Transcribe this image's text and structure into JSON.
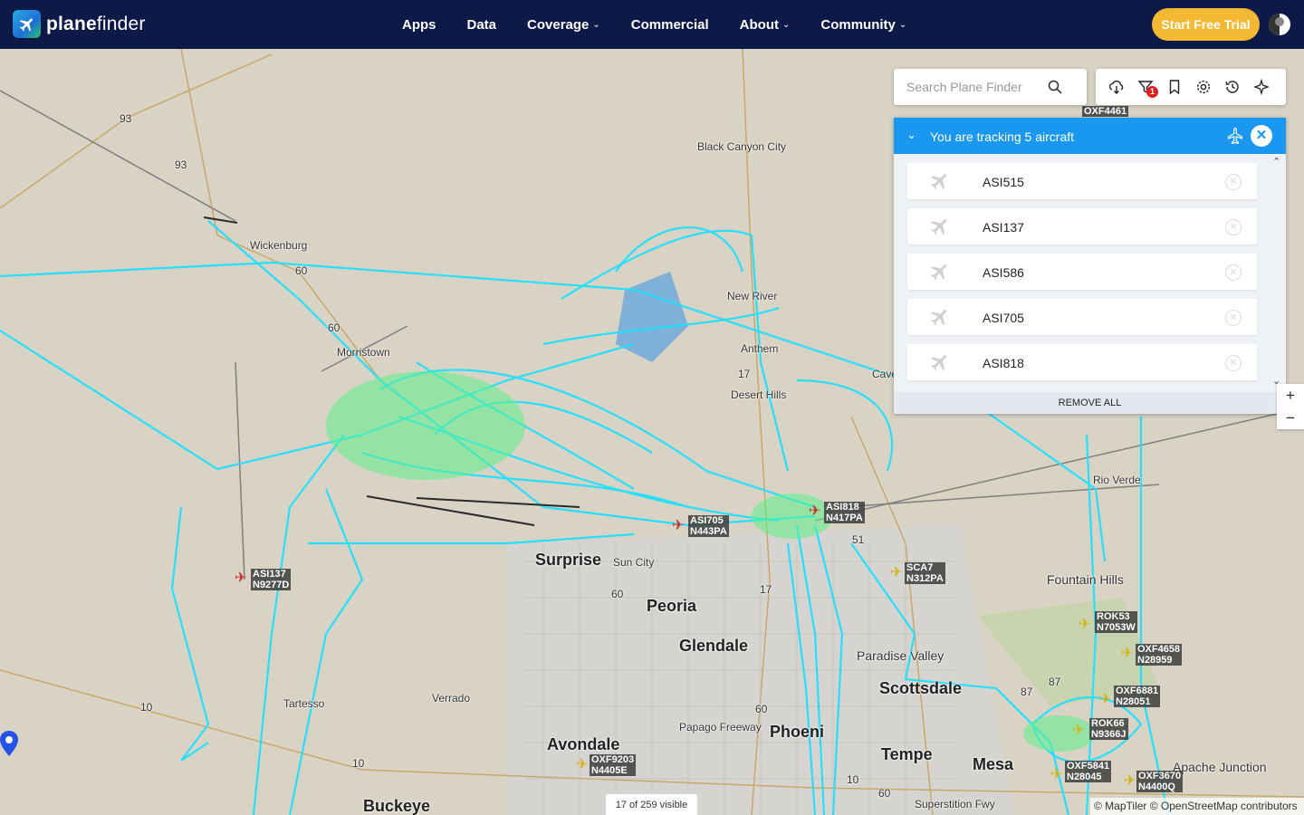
{
  "brand": {
    "name_bold": "plane",
    "name_rest": "finder"
  },
  "nav": {
    "items": [
      {
        "label": "Apps",
        "dropdown": false
      },
      {
        "label": "Data",
        "dropdown": false
      },
      {
        "label": "Coverage",
        "dropdown": true
      },
      {
        "label": "Commercial",
        "dropdown": false
      },
      {
        "label": "About",
        "dropdown": true
      },
      {
        "label": "Community",
        "dropdown": true
      }
    ],
    "trial_label": "Start Free Trial"
  },
  "search": {
    "placeholder": "Search Plane Finder"
  },
  "toolbar": {
    "filter_badge": "1",
    "icons": [
      "cloud-icon",
      "filter-icon",
      "bookmark-icon",
      "settings-icon",
      "history-icon",
      "radar-icon"
    ]
  },
  "tracking": {
    "title": "You are tracking 5 aircraft",
    "items": [
      "ASI515",
      "ASI137",
      "ASI586",
      "ASI705",
      "ASI818"
    ],
    "remove_all": "REMOVE ALL"
  },
  "zoom": {
    "in": "+",
    "out": "−"
  },
  "status": {
    "visible": "17 of 259 visible"
  },
  "attribution": "© MapTiler © OpenStreetMap contributors",
  "map": {
    "places": [
      {
        "name": "Black Canyon City",
        "big": false
      },
      {
        "name": "Wickenburg",
        "big": false
      },
      {
        "name": "New River",
        "big": false
      },
      {
        "name": "Anthem",
        "big": false
      },
      {
        "name": "Morristown",
        "big": false
      },
      {
        "name": "Desert Hills",
        "big": false
      },
      {
        "name": "Cave",
        "big": false
      },
      {
        "name": "Rio Verde",
        "big": false
      },
      {
        "name": "Surprise",
        "big": true
      },
      {
        "name": "Sun City",
        "big": false
      },
      {
        "name": "Peoria",
        "big": true
      },
      {
        "name": "Glendale",
        "big": true
      },
      {
        "name": "Fountain Hills",
        "big": false
      },
      {
        "name": "Paradise Valley",
        "big": false
      },
      {
        "name": "Scottsdale",
        "big": true
      },
      {
        "name": "Tartesso",
        "big": false
      },
      {
        "name": "Verrado",
        "big": false
      },
      {
        "name": "Papago Freeway",
        "big": false
      },
      {
        "name": "Phoeni",
        "big": true
      },
      {
        "name": "Avondale",
        "big": true
      },
      {
        "name": "Tempe",
        "big": true
      },
      {
        "name": "Mesa",
        "big": true
      },
      {
        "name": "Apache Junction",
        "big": false
      },
      {
        "name": "Buckeye",
        "big": true
      },
      {
        "name": "Superstition Fwy",
        "big": false
      }
    ],
    "aircraft": [
      {
        "callsign": "OXF4461",
        "reg": "",
        "color": "yellow"
      },
      {
        "callsign": "ASI818",
        "reg": "N417PA",
        "color": "red"
      },
      {
        "callsign": "ASI705",
        "reg": "N443PA",
        "color": "red"
      },
      {
        "callsign": "ASI137",
        "reg": "N9277D",
        "color": "red"
      },
      {
        "callsign": "SCA7",
        "reg": "N312PA",
        "color": "yellow"
      },
      {
        "callsign": "ROK53",
        "reg": "N7053W",
        "color": "yellow"
      },
      {
        "callsign": "OXF4658",
        "reg": "N28959",
        "color": "yellow"
      },
      {
        "callsign": "OXF6881",
        "reg": "N28051",
        "color": "yellow"
      },
      {
        "callsign": "ROK66",
        "reg": "N9366J",
        "color": "yellow"
      },
      {
        "callsign": "OXF5841",
        "reg": "N28045",
        "color": "yellow"
      },
      {
        "callsign": "OXF3670",
        "reg": "N4400Q",
        "color": "yellow"
      },
      {
        "callsign": "OXF9203",
        "reg": "N4405E",
        "color": "yellow"
      }
    ],
    "routes": [
      "93",
      "93",
      "60",
      "60",
      "17",
      "51",
      "17",
      "60",
      "87",
      "87",
      "10",
      "10",
      "60",
      "10",
      "60"
    ]
  }
}
